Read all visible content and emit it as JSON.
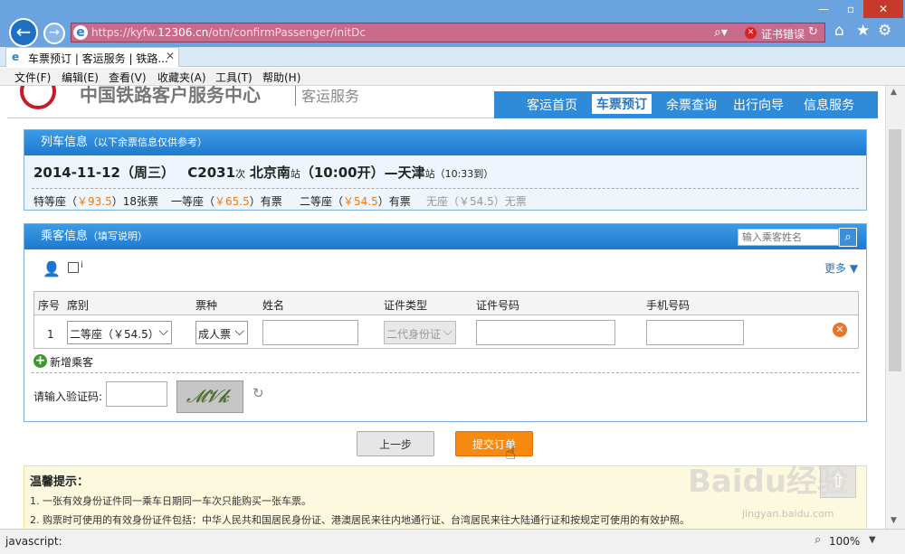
{
  "browser": {
    "url_prefix": "https://kyfw.",
    "url_domain": "12306.cn",
    "url_path": "/otn/confirmPassenger/initDc",
    "cert_error": "证书错误",
    "tab_title": "车票预订 | 客运服务 | 铁路...",
    "menu": [
      "文件(F)",
      "编辑(E)",
      "查看(V)",
      "收藏夹(A)",
      "工具(T)",
      "帮助(H)"
    ],
    "status_text": "javascript:",
    "zoom": "100%",
    "icons": {
      "back": "back-arrow-icon",
      "forward": "forward-arrow-icon",
      "home": "home-icon",
      "favorites": "star-icon",
      "tools": "gear-icon"
    }
  },
  "header": {
    "logo_title": "中国铁路客户服务中心",
    "logo_sub": "客运服务",
    "nav": [
      "客运首页",
      "车票预订",
      "余票查询",
      "出行向导",
      "信息服务"
    ],
    "active_nav": "车票预订"
  },
  "train_panel": {
    "title": "列车信息",
    "note": "（以下余票信息仅供参考）",
    "date": "2014-11-12（周三）",
    "train_no": "C2031",
    "train_suffix": "次",
    "from": "北京南",
    "from_suffix": "站",
    "depart": "（10:00开）—",
    "to": "天津",
    "to_suffix": "站",
    "arrive": "（10:33到）",
    "seats": [
      {
        "name": "特等座（",
        "price": "￥93.5",
        "after": "）18张票",
        "available": true
      },
      {
        "name": "一等座（",
        "price": "￥65.5",
        "after": "）有票",
        "available": true
      },
      {
        "name": "二等座（",
        "price": "￥54.5",
        "after": "）有票",
        "available": true
      },
      {
        "name": "无座（",
        "price": "￥54.5",
        "after": "）无票",
        "available": false
      }
    ]
  },
  "passenger_panel": {
    "title": "乘客信息",
    "note": "（填写说明）",
    "search_placeholder": "输入乘客姓名",
    "checkbox_label": "i",
    "more": "更多",
    "columns": [
      "序号",
      "席别",
      "票种",
      "姓名",
      "证件类型",
      "证件号码",
      "手机号码"
    ],
    "rows": [
      {
        "index": "1",
        "seat": "二等座（￥54.5）",
        "ticket_type": "成人票",
        "name": "",
        "id_type": "二代身份证",
        "id_no": "",
        "phone": ""
      }
    ],
    "add_passenger": "新增乘客",
    "captcha_label": "请输入验证码:",
    "captcha_value": ""
  },
  "actions": {
    "prev": "上一步",
    "submit": "提交订单"
  },
  "tips": {
    "title": "温馨提示：",
    "items": [
      "1. 一张有效身份证件同一乘车日期同一车次只能购买一张车票。",
      "2. 购票时可使用的有效身份证件包括：中华人民共和国居民身份证、港澳居民来往内地通行证、台湾居民来往大陆通行证和按规定可使用的有效护照。"
    ]
  },
  "watermark": {
    "main": "Baidu经验",
    "sub": "jingyan.baidu.com"
  },
  "colors": {
    "accent": "#2f8ad8",
    "price": "#f07b10",
    "submit": "#f7890e",
    "address_bar": "#c86a8a"
  }
}
